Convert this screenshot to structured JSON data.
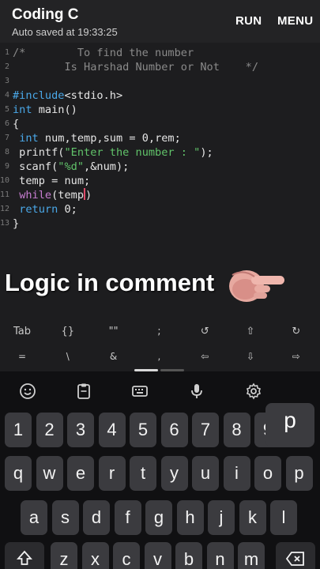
{
  "app": {
    "title": "Coding C",
    "subtitle": "Auto saved at 19:33:25",
    "run_label": "RUN",
    "menu_label": "MENU"
  },
  "code_lines": [
    {
      "n": "1",
      "parts": [
        [
          "cm",
          "/*        To find the number"
        ]
      ]
    },
    {
      "n": "2",
      "parts": [
        [
          "cm",
          "        Is Harshad Number or Not    */"
        ]
      ]
    },
    {
      "n": "3",
      "parts": [
        [
          "pl",
          ""
        ]
      ]
    },
    {
      "n": "4",
      "parts": [
        [
          "pp",
          "#include"
        ],
        [
          "pl",
          "<stdio.h>"
        ]
      ]
    },
    {
      "n": "5",
      "parts": [
        [
          "kw",
          "int"
        ],
        [
          "pl",
          " main()"
        ]
      ]
    },
    {
      "n": "6",
      "parts": [
        [
          "pl",
          "{"
        ]
      ]
    },
    {
      "n": "7",
      "parts": [
        [
          "pl",
          " "
        ],
        [
          "kw",
          "int"
        ],
        [
          "pl",
          " num,temp,sum = 0,rem;"
        ]
      ]
    },
    {
      "n": "8",
      "parts": [
        [
          "pl",
          " printf("
        ],
        [
          "str",
          "\"Enter the number : \""
        ],
        [
          "pl",
          ");"
        ]
      ]
    },
    {
      "n": "9",
      "parts": [
        [
          "pl",
          " scanf("
        ],
        [
          "str",
          "\"%d\""
        ],
        [
          "pl",
          ",&num);"
        ]
      ]
    },
    {
      "n": "10",
      "parts": [
        [
          "pl",
          " temp = num;"
        ]
      ]
    },
    {
      "n": "11",
      "parts": [
        [
          "pl",
          " "
        ],
        [
          "fn",
          "while"
        ],
        [
          "pl",
          "(temp"
        ],
        [
          "cursor",
          ""
        ],
        [
          "pl",
          ")"
        ]
      ]
    },
    {
      "n": "12",
      "parts": [
        [
          "pl",
          " "
        ],
        [
          "kw",
          "return"
        ],
        [
          "pl",
          " 0;"
        ]
      ]
    },
    {
      "n": "13",
      "parts": [
        [
          "pl",
          "}"
        ]
      ]
    }
  ],
  "caption": "Logic in comment",
  "extra_keys": {
    "row1": [
      "Tab",
      "{}",
      "\"\"",
      ";",
      "↺",
      "⇧",
      "↻"
    ],
    "row2": [
      "=",
      "\\",
      "&",
      ",",
      "⇦",
      "⇩",
      "⇨"
    ]
  },
  "keyboard": {
    "toolbar": [
      "emoji-icon",
      "clipboard-icon",
      "keyboard-icon",
      "mic-icon",
      "settings-icon"
    ],
    "row_numbers": [
      "1",
      "2",
      "3",
      "4",
      "5",
      "6",
      "7",
      "8",
      "9"
    ],
    "row_q": [
      "q",
      "w",
      "e",
      "r",
      "t",
      "y",
      "u",
      "i",
      "o",
      "p"
    ],
    "row_a": [
      "a",
      "s",
      "d",
      "f",
      "g",
      "h",
      "j",
      "k",
      "l"
    ],
    "row_z": [
      "z",
      "x",
      "c",
      "v",
      "b",
      "n",
      "m"
    ],
    "popup_key": "p",
    "shift_icon": "shift-icon",
    "backspace_icon": "backspace-icon"
  },
  "colors": {
    "keyword": "#4aa8e8",
    "string": "#61c36a",
    "comment": "#8a8a8a",
    "function": "#c77dd1",
    "cursor": "#e04b6a"
  }
}
